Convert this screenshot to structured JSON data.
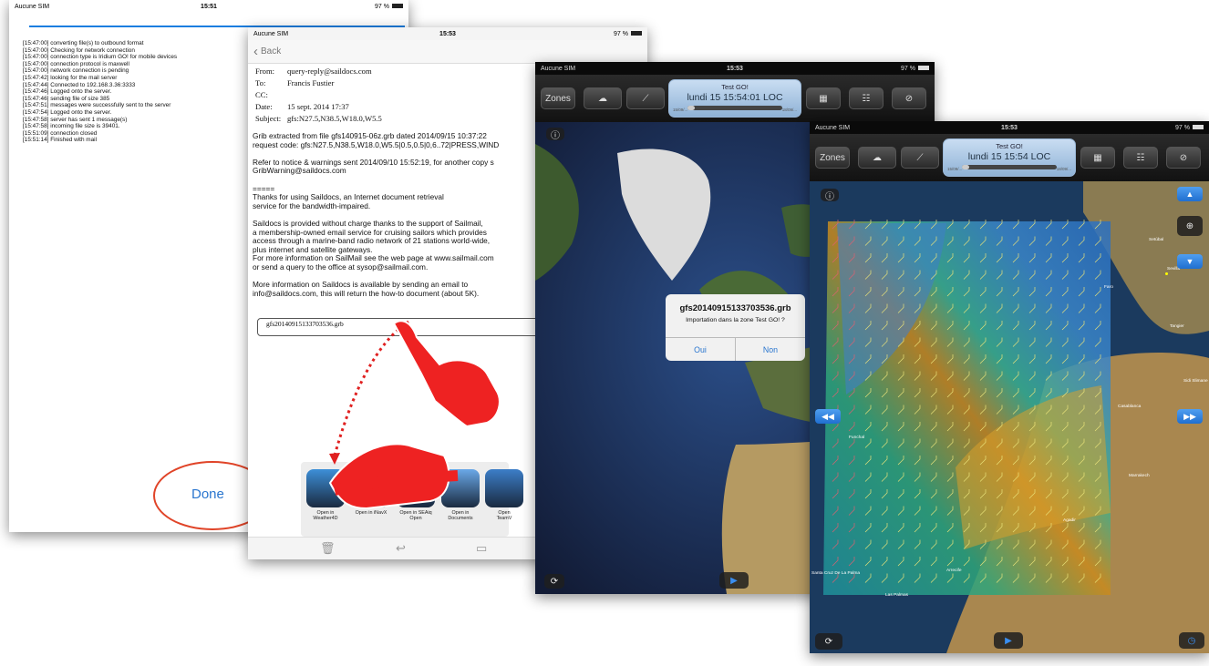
{
  "log_screen": {
    "status": {
      "carrier": "Aucune SIM",
      "time": "15:51",
      "battery": "97 %"
    },
    "log_lines": [
      "[15:47:00] converting file(s) to outbound format",
      "[15:47:00] Checking for network connection",
      "[15:47:00] connection type is Iridium GO! for mobile devices",
      "[15:47:00] connection protocol is maxwell",
      "[15:47:00] network connection is pending",
      "[15:47:42] looking for the mail server",
      "[15:47:44] Connected to 192.168.3.36:3333",
      "[15:47:46] Logged onto the server.",
      "[15:47:46] sending file of size 385",
      "[15:47:51] messages were successfully sent to the server",
      "[15:47:54] Logged onto the server.",
      "[15:47:58] server has sent 1 message(s)",
      "[15:47:58] incoming file size is 39401.",
      "[15:51:09] connection closed",
      "[15:51:14] Finished with mail"
    ],
    "done_label": "Done"
  },
  "mail_screen": {
    "status": {
      "carrier": "Aucune SIM",
      "time": "15:53",
      "battery": "97 %"
    },
    "back_label": "Back",
    "from_label": "From:",
    "from": "query-reply@saildocs.com",
    "to_label": "To:",
    "to": "Francis Fustier",
    "cc_label": "CC:",
    "date_label": "Date:",
    "date": "15 sept. 2014 17:37",
    "subject_label": "Subject:",
    "subject": "gfs:N27.5,N38.5,W18.0,W5.5",
    "body": "Grib extracted from file gfs140915-06z.grb dated 2014/09/15 10:37:22\nrequest code: gfs:N27.5,N38.5,W18.0,W5.5|0.5,0.5|0,6..72|PRESS,WIND\n\nRefer to notice & warnings sent 2014/09/10 15:52:19, for another copy s\nGribWarning@saildocs.com\n\n=====\nThanks for using Saildocs, an Internet document retrieval\nservice for the bandwidth-impaired.\n\nSaildocs is provided without charge thanks to the support of Sailmail,\na membership-owned email service for cruising sailors which provides\naccess through a marine-band radio network of 21 stations world-wide,\nplus internet and satellite gateways.\nFor more information on SailMail see the web page at www.sailmail.com\nor send a query to the office at sysop@sailmail.com.\n\nMore information on Saildocs is available by sending an email to\ninfo@saildocs.com, this will return the how-to document (about 5K).",
    "attachment": "gfs20140915133703536.grb",
    "apps": [
      {
        "label": "Open in\nWeather4D",
        "color": "#3d8fd8"
      },
      {
        "label": "Open in iNavX",
        "color": "#8a7a5a"
      },
      {
        "label": "Open in SEAiq\nOpen",
        "color": "#2a5f98"
      },
      {
        "label": "Open in\nDocuments",
        "color": "#6aa8e8"
      },
      {
        "label": "Open\nTeamV",
        "color": "#3c7ec8"
      }
    ]
  },
  "map_screen_1": {
    "status": {
      "carrier": "Aucune SIM",
      "time": "15:53",
      "battery": "97 %"
    },
    "zones_label": "Zones",
    "pane_title": "Test GO!",
    "pane_time": "lundi 15 15:54:01 LOC",
    "pane_min": "15/09/...",
    "pane_max": "18/09/...",
    "dialog": {
      "title": "gfs20140915133703536.grb",
      "message": "Importation dans la zone Test GO! ?",
      "yes": "Oui",
      "no": "Non"
    }
  },
  "map_screen_2": {
    "status": {
      "carrier": "Aucune SIM",
      "time": "15:53",
      "battery": "97 %"
    },
    "zones_label": "Zones",
    "pane_title": "Test GO!",
    "pane_time": "lundi 15 15:54 LOC",
    "pane_min": "15/09/...",
    "pane_max": "18/09/...",
    "cities": [
      "Sevilla",
      "Faro",
      "Tangier",
      "Casablanca",
      "Sidi Slimane",
      "Funchal",
      "Marrakech",
      "Agadir",
      "Arrecife",
      "Santa Cruz De La Palma",
      "Las Palmas",
      "Setúbal"
    ]
  },
  "colors": {
    "accent": "#2a76cf",
    "annotation": "#e02020"
  }
}
